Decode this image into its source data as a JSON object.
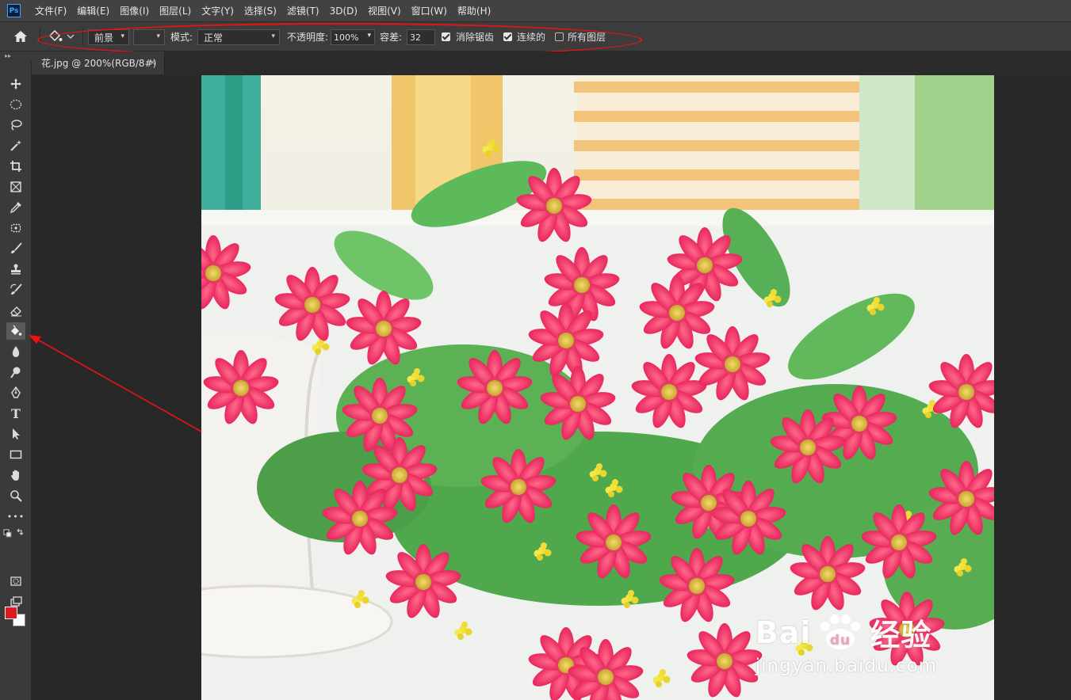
{
  "app": {
    "logo_text": "Ps"
  },
  "menu": [
    "文件(F)",
    "编辑(E)",
    "图像(I)",
    "图层(L)",
    "文字(Y)",
    "选择(S)",
    "滤镜(T)",
    "3D(D)",
    "视图(V)",
    "窗口(W)",
    "帮助(H)"
  ],
  "options": {
    "fill_source": "前景",
    "mode_label": "模式:",
    "mode_value": "正常",
    "opacity_label": "不透明度:",
    "opacity_value": "100%",
    "tolerance_label": "容差:",
    "tolerance_value": "32",
    "antialias_label": "消除锯齿",
    "antialias_checked": true,
    "contiguous_label": "连续的",
    "contiguous_checked": true,
    "all_layers_label": "所有图层",
    "all_layers_checked": false
  },
  "document": {
    "tab_title": "花.jpg @ 200%(RGB/8#)",
    "close_glyph": "×"
  },
  "toolbar": {
    "tools": [
      "move-tool",
      "marquee-tool",
      "lasso-tool",
      "magic-wand-tool",
      "crop-tool",
      "frame-tool",
      "eyedropper-tool",
      "patch-tool",
      "brush-tool",
      "stamp-tool",
      "history-brush-tool",
      "eraser-tool",
      "paint-bucket-tool",
      "blur-tool",
      "dodge-tool",
      "pen-tool",
      "type-tool",
      "path-select-tool",
      "rectangle-tool",
      "hand-tool",
      "zoom-tool",
      "more-tools"
    ],
    "active_tool": "paint-bucket-tool",
    "collapse_glyph": "▸▸",
    "type_glyph": "T",
    "more_glyph": "•••"
  },
  "colors": {
    "foreground": "#e0191f",
    "background": "#ffffff",
    "annotation": "#e11111"
  },
  "watermark": {
    "brand_text": "Bai",
    "du_text": "du",
    "brand_cn": "经验",
    "url": "jingyan.baidu.com"
  }
}
